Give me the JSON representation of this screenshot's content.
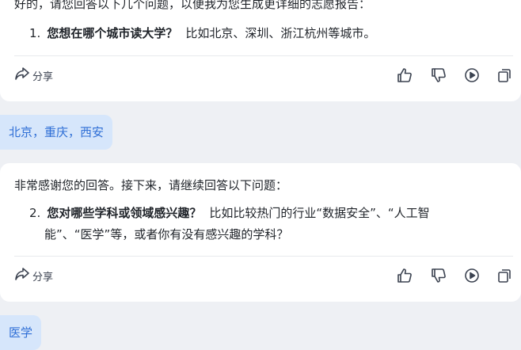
{
  "conversation": {
    "message1": {
      "intro": "好的，请您回答以下几个问题，以便我为您生成更详细的志愿报告：",
      "question": {
        "number": "1.",
        "bold": "您想在哪个城市读大学？",
        "detail": "比如北京、深圳、浙江杭州等城市。"
      },
      "share_label": "分享"
    },
    "user_reply1": "北京，重庆，西安",
    "message2": {
      "intro": "非常感谢您的回答。接下来，请继续回答以下问题：",
      "question": {
        "number": "2.",
        "bold": "您对哪些学科或领域感兴趣？",
        "detail_line1": "比如比较热门的行业“数据安全”、“人工智",
        "detail_line2": "能”、“医学”等，或者你有没有感兴趣的学科？"
      },
      "share_label": "分享"
    },
    "user_reply2": "医学"
  },
  "icons": {
    "share": "share-icon",
    "like": "thumbs-up-icon",
    "dislike": "thumbs-down-icon",
    "play": "play-icon",
    "copy": "copy-icon"
  },
  "colors": {
    "background": "#eef0f4",
    "card": "#ffffff",
    "user_bubble": "#d6e6fb",
    "user_text": "#2f6fd6",
    "icon": "#3b4250"
  }
}
